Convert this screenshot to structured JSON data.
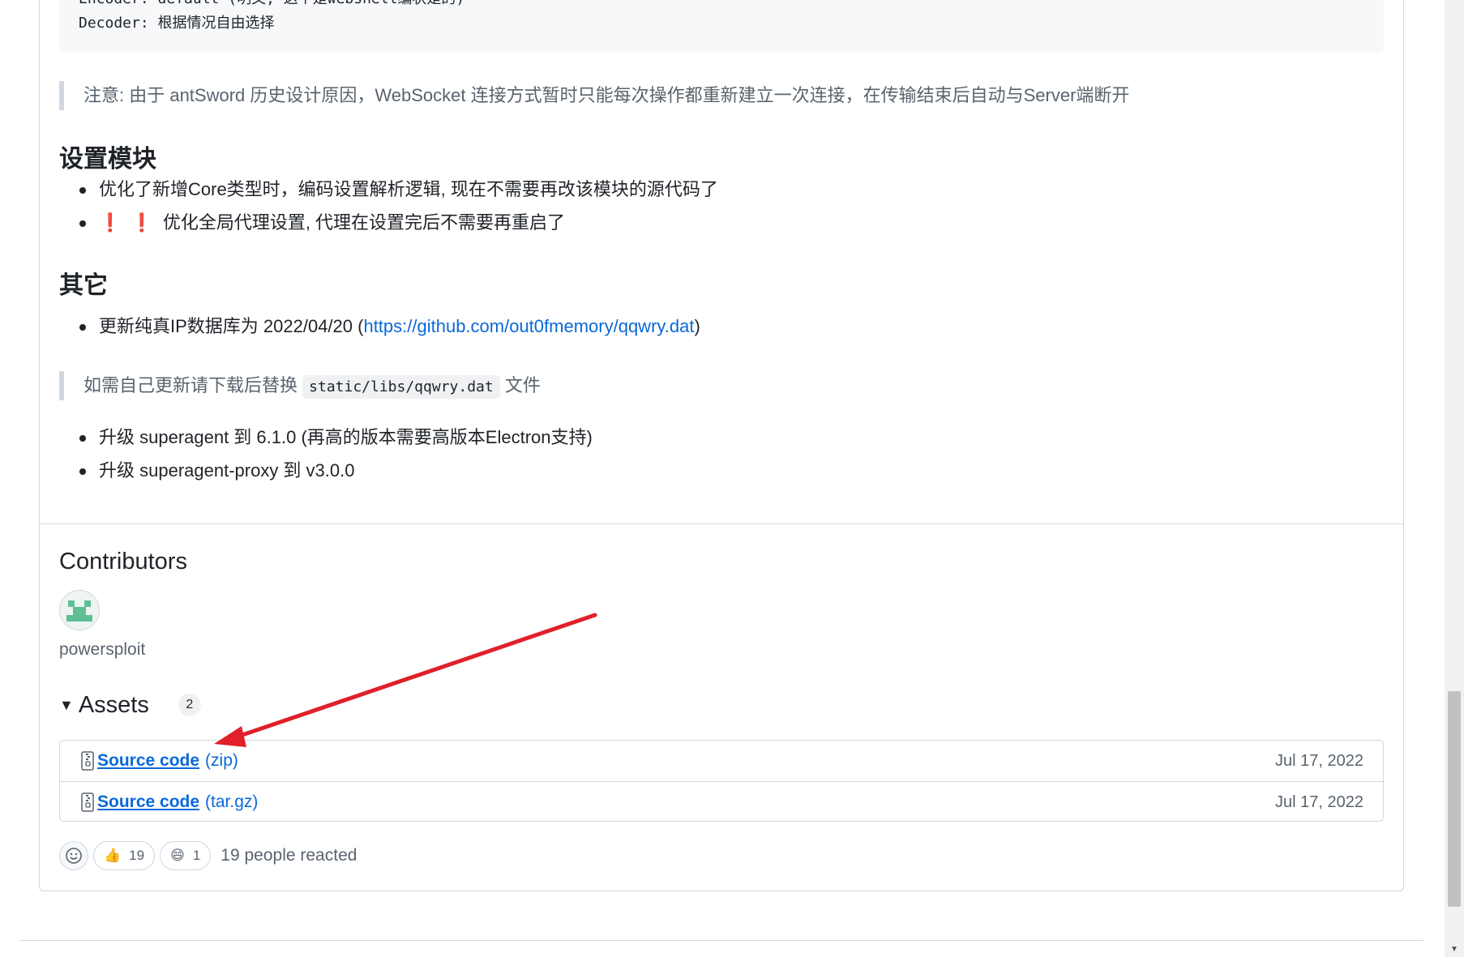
{
  "code": {
    "line1": "Encoder: default (明文, 这个是webshell编状是的)",
    "line2": "Decoder: 根据情况自由选择"
  },
  "note1": "注意: 由于 antSword 历史设计原因，WebSocket 连接方式暂时只能每次操作都重新建立一次连接，在传输结束后自动与Server端断开",
  "settings": {
    "title": "设置模块",
    "items": [
      "优化了新增Core类型时，编码设置解析逻辑, 现在不需要再改该模块的源代码了",
      "优化全局代理设置, 代理在设置完后不需要再重启了"
    ],
    "exclamation": "❗"
  },
  "other": {
    "title": "其它",
    "item1_prefix": "更新纯真IP数据库为 2022/04/20 (",
    "item1_link": "https://github.com/out0fmemory/qqwry.dat",
    "item1_suffix": ")",
    "quote_prefix": "如需自己更新请下载后替换",
    "quote_code": "static/libs/qqwry.dat",
    "quote_suffix": "文件",
    "items": [
      "升级 superagent 到 6.1.0 (再高的版本需要高版本Electron支持)",
      "升级 superagent-proxy 到 v3.0.0"
    ]
  },
  "contributors": {
    "title": "Contributors",
    "name": "powersploit"
  },
  "assets": {
    "title": "Assets",
    "count": "2",
    "items": [
      {
        "name": "Source code",
        "ext": "(zip)",
        "date": "Jul 17, 2022"
      },
      {
        "name": "Source code",
        "ext": "(tar.gz)",
        "date": "Jul 17, 2022"
      }
    ]
  },
  "reactions": {
    "thumbs_emoji": "👍",
    "thumbs_count": "19",
    "laugh_emoji": "😄",
    "laugh_count": "1",
    "summary": "19 people reacted"
  },
  "colors": {
    "link": "#0969da",
    "annotation_arrow": "#e0202a",
    "avatar": "#5fbf94"
  }
}
